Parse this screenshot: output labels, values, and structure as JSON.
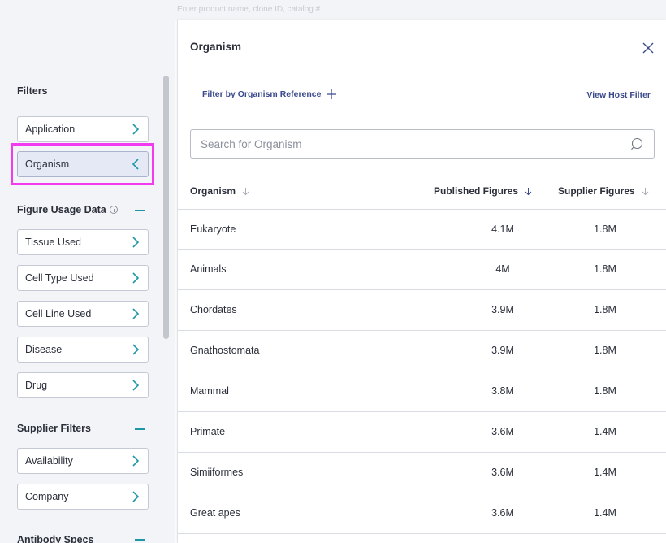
{
  "top_strip": {
    "text": "Enter product name, clone ID, catalog #"
  },
  "sidebar": {
    "filters_heading": "Filters",
    "top_items": [
      {
        "label": "Application",
        "state": "collapsed"
      },
      {
        "label": "Organism",
        "state": "expanded"
      }
    ],
    "figure_usage": {
      "heading": "Figure Usage Data",
      "items": [
        "Tissue Used",
        "Cell Type Used",
        "Cell Line Used",
        "Disease",
        "Drug"
      ]
    },
    "supplier_filters": {
      "heading": "Supplier Filters",
      "items": [
        "Availability",
        "Company"
      ]
    },
    "antibody_specs": {
      "heading": "Antibody Specs"
    }
  },
  "modal": {
    "title": "Organism",
    "filter_by_reference": "Filter by Organism Reference",
    "view_host_filter": "View Host Filter",
    "search_placeholder": "Search for Organism",
    "columns": {
      "organism": "Organism",
      "published": "Published Figures",
      "supplier": "Supplier Figures"
    },
    "rows": [
      {
        "organism": "Eukaryote",
        "published": "4.1M",
        "supplier": "1.8M"
      },
      {
        "organism": "Animals",
        "published": "4M",
        "supplier": "1.8M"
      },
      {
        "organism": "Chordates",
        "published": "3.9M",
        "supplier": "1.8M"
      },
      {
        "organism": "Gnathostomata",
        "published": "3.9M",
        "supplier": "1.8M"
      },
      {
        "organism": "Mammal",
        "published": "3.8M",
        "supplier": "1.8M"
      },
      {
        "organism": "Primate",
        "published": "3.6M",
        "supplier": "1.4M"
      },
      {
        "organism": "Simiiformes",
        "published": "3.6M",
        "supplier": "1.4M"
      },
      {
        "organism": "Great apes",
        "published": "3.6M",
        "supplier": "1.4M"
      }
    ]
  },
  "colors": {
    "accent_teal": "#1d97a6",
    "link_blue": "#3a4a8c",
    "highlight_magenta": "#f23af0",
    "active_item_bg": "#e4e9f5"
  },
  "icons": {
    "collapsed_item": "chevron-right-icon",
    "expanded_item": "chevron-left-icon",
    "section_toggle": "minus-icon",
    "info": "info-icon",
    "close": "close-icon",
    "add": "plus-icon",
    "search": "search-icon",
    "sort": "arrow-down-icon"
  }
}
